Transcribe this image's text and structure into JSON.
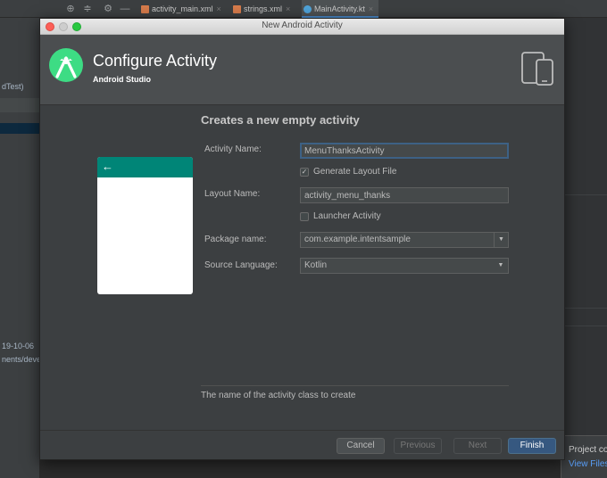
{
  "ide": {
    "tabs": [
      {
        "label": "activity_main.xml",
        "close": "×",
        "icon_color": "#d67b4b"
      },
      {
        "label": "strings.xml",
        "close": "×",
        "icon_color": "#d67b4b"
      },
      {
        "label": "MainActivity.kt",
        "close": "×",
        "icon_color": "#4fa3d9"
      }
    ],
    "toolbar_icons": [
      "target-icon",
      "collapse-icon",
      "gear-icon",
      "minimize-icon"
    ],
    "left_fragments": {
      "androidtest": "dTest)",
      "date": "19-10-06",
      "path": "nents/deve"
    },
    "notification": {
      "title": "Project co",
      "link": "View Files"
    }
  },
  "dialog": {
    "window_title": "New Android Activity",
    "header": {
      "title": "Configure Activity",
      "subtitle": "Android Studio",
      "logo_icon": "android-studio-logo-icon",
      "devices_icon": "phone-tablet-icon"
    },
    "heading": "Creates a new empty activity",
    "preview": {
      "back_icon": "←",
      "appbar_color": "#008577"
    },
    "form": {
      "activity_name_label": "Activity Name:",
      "activity_name_value": "MenuThanksActivity",
      "generate_layout_label": "Generate Layout File",
      "generate_layout_checked": true,
      "check_glyph": "✓",
      "layout_name_label": "Layout Name:",
      "layout_name_value": "activity_menu_thanks",
      "launcher_activity_label": "Launcher Activity",
      "launcher_activity_checked": false,
      "package_name_label": "Package name:",
      "package_name_value": "com.example.intentsample",
      "source_language_label": "Source Language:",
      "source_language_value": "Kotlin",
      "dropdown_glyph": "▼"
    },
    "help_text": "The name of the activity class to create",
    "buttons": {
      "cancel": "Cancel",
      "previous": "Previous",
      "next": "Next",
      "finish": "Finish"
    }
  },
  "colors": {
    "accent": "#365880",
    "android_green": "#3ddc84",
    "focus_border": "#3d6185"
  }
}
